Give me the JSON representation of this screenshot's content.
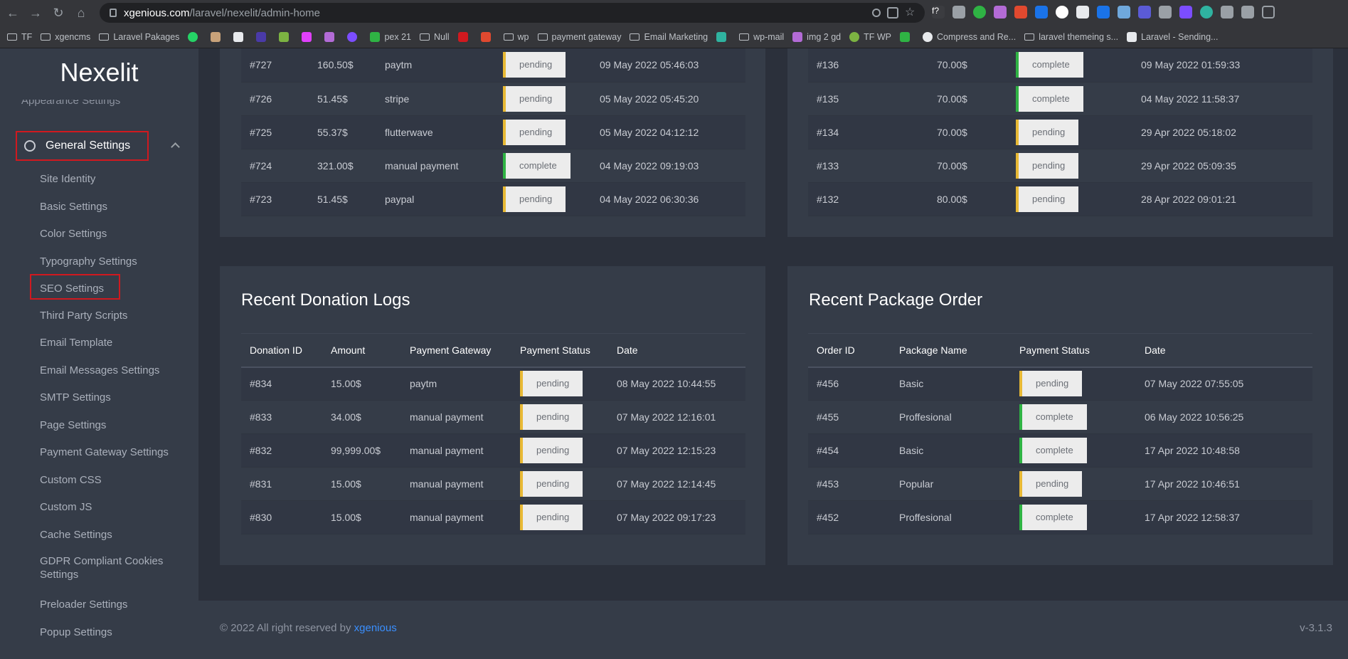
{
  "browser": {
    "url_host": "xgenious.com",
    "url_path": "/laravel/nexelit/admin-home",
    "bookmarks": [
      "TF",
      "xgencms",
      "Laravel Pakages",
      "pex 21",
      "Null",
      "wp",
      "payment gateway",
      "Email Marketing",
      "wp-mail",
      "img 2 gd",
      "TF WP",
      "Compress and Re...",
      "laravel themeing s...",
      "Laravel - Sending..."
    ]
  },
  "sidebar": {
    "brand": "Nexelit",
    "partial_item": "Appearance Settings",
    "active_item": "General Settings",
    "items": [
      "Site Identity",
      "Basic Settings",
      "Color Settings",
      "Typography Settings",
      "SEO Settings",
      "Third Party Scripts",
      "Email Template",
      "Email Messages Settings",
      "SMTP Settings",
      "Page Settings",
      "Payment Gateway Settings",
      "Custom CSS",
      "Custom JS",
      "Cache Settings",
      "GDPR Compliant Cookies Settings",
      "Preloader Settings",
      "Popup Settings"
    ]
  },
  "top_left_rows": [
    {
      "id": "#727",
      "amount": "160.50$",
      "gateway": "paytm",
      "status": "pending",
      "date": "09 May 2022 05:46:03"
    },
    {
      "id": "#726",
      "amount": "51.45$",
      "gateway": "stripe",
      "status": "pending",
      "date": "05 May 2022 05:45:20"
    },
    {
      "id": "#725",
      "amount": "55.37$",
      "gateway": "flutterwave",
      "status": "pending",
      "date": "05 May 2022 04:12:12"
    },
    {
      "id": "#724",
      "amount": "321.00$",
      "gateway": "manual payment",
      "status": "complete",
      "date": "04 May 2022 09:19:03"
    },
    {
      "id": "#723",
      "amount": "51.45$",
      "gateway": "paypal",
      "status": "pending",
      "date": "04 May 2022 06:30:36"
    }
  ],
  "top_right_rows": [
    {
      "id": "#136",
      "amount": "70.00$",
      "status": "complete",
      "date": "09 May 2022 01:59:33"
    },
    {
      "id": "#135",
      "amount": "70.00$",
      "status": "complete",
      "date": "04 May 2022 11:58:37"
    },
    {
      "id": "#134",
      "amount": "70.00$",
      "status": "pending",
      "date": "29 Apr 2022 05:18:02"
    },
    {
      "id": "#133",
      "amount": "70.00$",
      "status": "pending",
      "date": "29 Apr 2022 05:09:35"
    },
    {
      "id": "#132",
      "amount": "80.00$",
      "status": "pending",
      "date": "28 Apr 2022 09:01:21"
    }
  ],
  "donations": {
    "title": "Recent Donation Logs",
    "headers": [
      "Donation ID",
      "Amount",
      "Payment Gateway",
      "Payment Status",
      "Date"
    ],
    "rows": [
      {
        "id": "#834",
        "amount": "15.00$",
        "gateway": "paytm",
        "status": "pending",
        "date": "08 May 2022 10:44:55"
      },
      {
        "id": "#833",
        "amount": "34.00$",
        "gateway": "manual payment",
        "status": "pending",
        "date": "07 May 2022 12:16:01"
      },
      {
        "id": "#832",
        "amount": "99,999.00$",
        "gateway": "manual payment",
        "status": "pending",
        "date": "07 May 2022 12:15:23"
      },
      {
        "id": "#831",
        "amount": "15.00$",
        "gateway": "manual payment",
        "status": "pending",
        "date": "07 May 2022 12:14:45"
      },
      {
        "id": "#830",
        "amount": "15.00$",
        "gateway": "manual payment",
        "status": "pending",
        "date": "07 May 2022 09:17:23"
      }
    ]
  },
  "packages": {
    "title": "Recent Package Order",
    "headers": [
      "Order ID",
      "Package Name",
      "Payment Status",
      "Date"
    ],
    "rows": [
      {
        "id": "#456",
        "name": "Basic",
        "status": "pending",
        "date": "07 May 2022 07:55:05"
      },
      {
        "id": "#455",
        "name": "Proffesional",
        "status": "complete",
        "date": "06 May 2022 10:56:25"
      },
      {
        "id": "#454",
        "name": "Basic",
        "status": "complete",
        "date": "17 Apr 2022 10:48:58"
      },
      {
        "id": "#453",
        "name": "Popular",
        "status": "pending",
        "date": "17 Apr 2022 10:46:51"
      },
      {
        "id": "#452",
        "name": "Proffesional",
        "status": "complete",
        "date": "17 Apr 2022 12:58:37"
      }
    ]
  },
  "footer": {
    "copyright": "© 2022 All right reserved by",
    "link": "xgenious",
    "version": "v-3.1.3"
  },
  "colors": {
    "pending": "#e8b935",
    "complete": "#2fb344",
    "highlight": "#d0191f",
    "link": "#3a8fff"
  }
}
